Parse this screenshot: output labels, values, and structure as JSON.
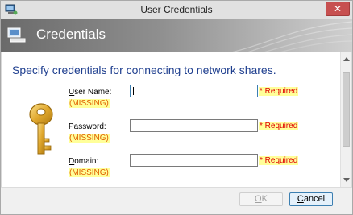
{
  "window": {
    "title": "User Credentials",
    "close_label": "✕"
  },
  "header": {
    "title": "Credentials"
  },
  "instruction": "Specify credentials for connecting to network shares.",
  "fields": [
    {
      "label": "User Name:",
      "status": "(MISSING)",
      "required": "* Required",
      "value": ""
    },
    {
      "label": "Password:",
      "status": "(MISSING)",
      "required": "* Required",
      "value": ""
    },
    {
      "label": "Domain:",
      "status": "(MISSING)",
      "required": "* Required",
      "value": ""
    }
  ],
  "buttons": {
    "ok": "OK",
    "cancel": "Cancel"
  },
  "colors": {
    "accent": "#1f3f8f",
    "required": "#e00000",
    "missing": "#e06000",
    "highlight": "#ffff99"
  },
  "icons": {
    "app": "computer-icon",
    "header": "computer-icon",
    "key": "key-icon"
  }
}
